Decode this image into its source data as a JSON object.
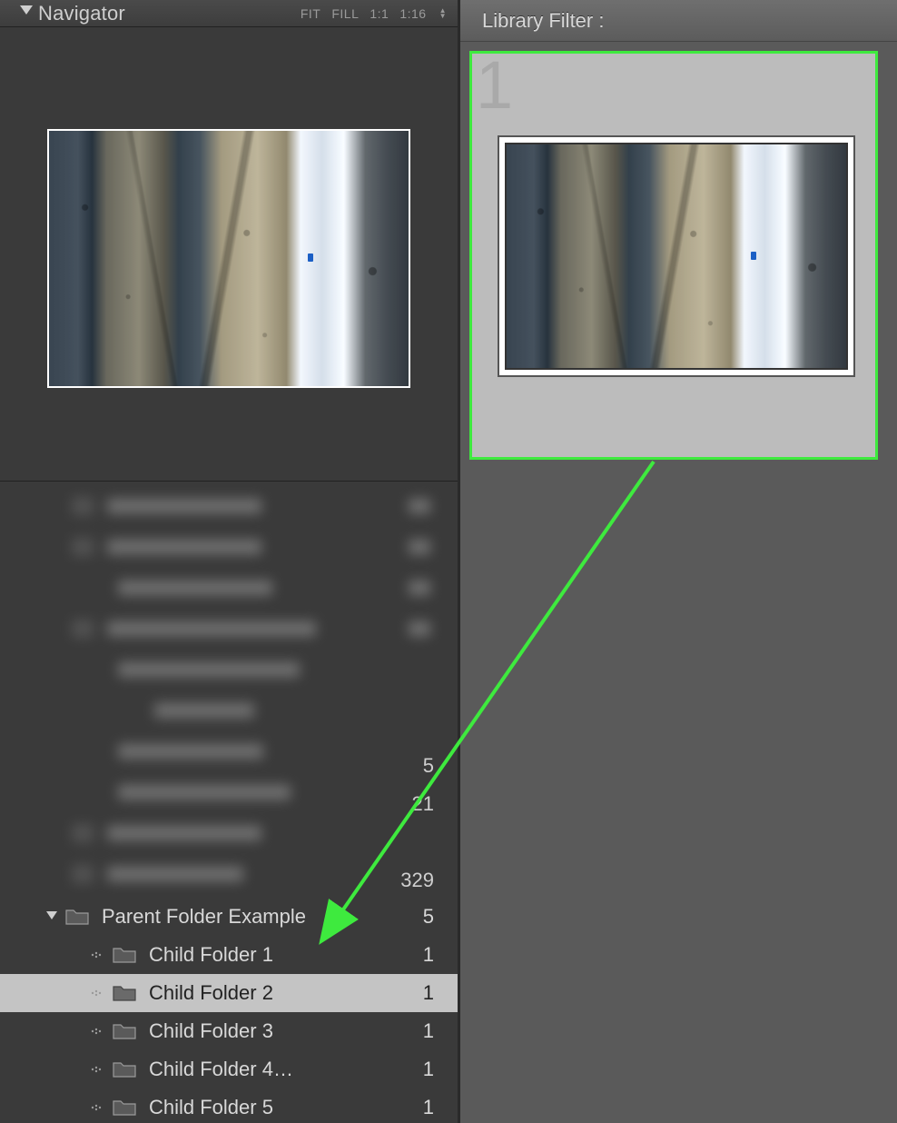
{
  "navigator": {
    "title": "Navigator",
    "zoom": {
      "fit": "FIT",
      "fill": "FILL",
      "one": "1:1",
      "ratio": "1:16"
    }
  },
  "libraryFilter": {
    "title": "Library Filter :"
  },
  "gridCell": {
    "index": "1"
  },
  "visibleCounts": {
    "a": "5",
    "b": "21",
    "c": "329"
  },
  "folders": {
    "parent": {
      "label": "Parent Folder Example",
      "count": "5"
    },
    "children": [
      {
        "label": "Child Folder 1",
        "count": "1",
        "selected": false
      },
      {
        "label": "Child Folder 2",
        "count": "1",
        "selected": true
      },
      {
        "label": "Child Folder 3",
        "count": "1",
        "selected": false
      },
      {
        "label": "Child Folder 4…",
        "count": "1",
        "selected": false
      },
      {
        "label": "Child Folder 5",
        "count": "1",
        "selected": false
      }
    ]
  }
}
